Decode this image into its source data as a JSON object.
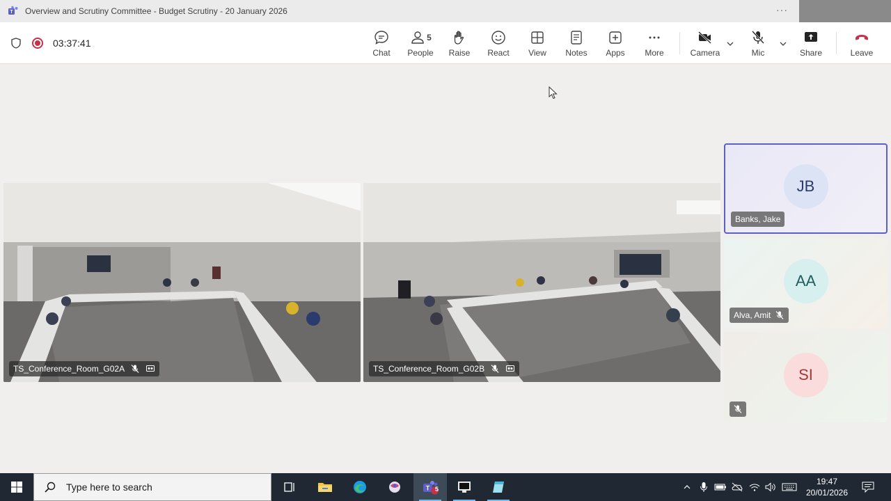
{
  "window": {
    "title": "Overview and Scrutiny Committee - Budget Scrutiny - 20 January 2026",
    "more_icon": "more-dots-icon"
  },
  "meeting": {
    "elapsed_time": "03:37:41",
    "recording": true
  },
  "toolbar": {
    "chat_label": "Chat",
    "people_label": "People",
    "people_count": "5",
    "raise_label": "Raise",
    "react_label": "React",
    "view_label": "View",
    "notes_label": "Notes",
    "apps_label": "Apps",
    "more_label": "More",
    "camera_label": "Camera",
    "mic_label": "Mic",
    "share_label": "Share",
    "leave_label": "Leave"
  },
  "videos": [
    {
      "name": "TS_Conference_Room_G02A",
      "muted": true
    },
    {
      "name": "TS_Conference_Room_G02B",
      "muted": true
    }
  ],
  "participants": [
    {
      "initials": "JB",
      "name": "Banks, Jake",
      "active_speaker": true,
      "muted": false,
      "avatar_bg": "#dce3f5",
      "avatar_fg": "#2b3a6b"
    },
    {
      "initials": "AA",
      "name": "Alva, Amit",
      "active_speaker": false,
      "muted": true,
      "avatar_bg": "#d8efef",
      "avatar_fg": "#1f5c5c"
    },
    {
      "initials": "SI",
      "name": "",
      "active_speaker": false,
      "muted": true,
      "avatar_bg": "#fadcdc",
      "avatar_fg": "#a4373a"
    }
  ],
  "taskbar": {
    "search_placeholder": "Type here to search",
    "teams_badge": "5",
    "time": "19:47",
    "date": "20/01/2026"
  },
  "colors": {
    "accent": "#5b5fc7",
    "leave": "#c4314b",
    "taskbar": "#1f2833"
  }
}
